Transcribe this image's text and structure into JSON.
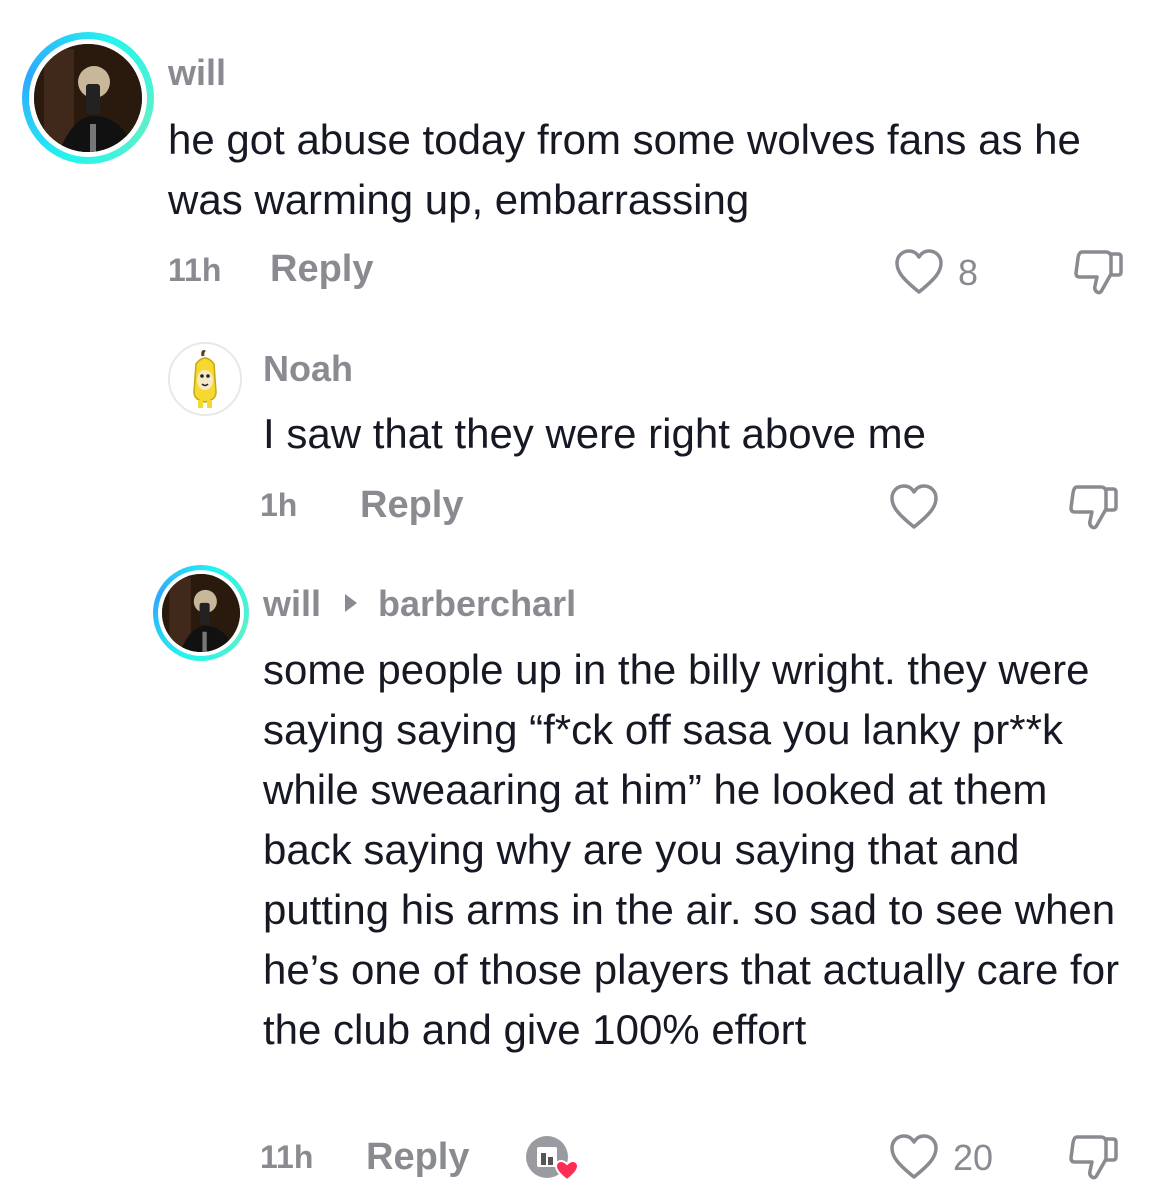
{
  "comments": [
    {
      "username": "will",
      "text": "he got abuse today from some wolves fans as he was warming up, embarrassing",
      "time": "11h",
      "reply_label": "Reply",
      "likes": "8"
    },
    {
      "username": "Noah",
      "text": "I saw that they were right above me",
      "time": "1h",
      "reply_label": "Reply",
      "likes": ""
    },
    {
      "username": "will",
      "reply_to": "barbercharl",
      "text": "some people up in the billy wright. they were saying saying “f*ck off sasa you lanky pr**k while sweaaring at him” he looked at them back saying why are you saying that and putting his arms in the air. so sad to see when he’s one of those players that actually care for the club and give 100% effort",
      "time": "11h",
      "reply_label": "Reply",
      "likes": "20"
    }
  ],
  "icons": {
    "like": "heart-outline-icon",
    "dislike": "thumbs-down-icon",
    "creator_liked": "creator-liked-badge-icon",
    "reply_arrow": "caret-right-icon"
  },
  "colors": {
    "text": "#161823",
    "muted": "#8a8b91",
    "ring": "#25f4ee",
    "heart": "#fe2c55"
  }
}
